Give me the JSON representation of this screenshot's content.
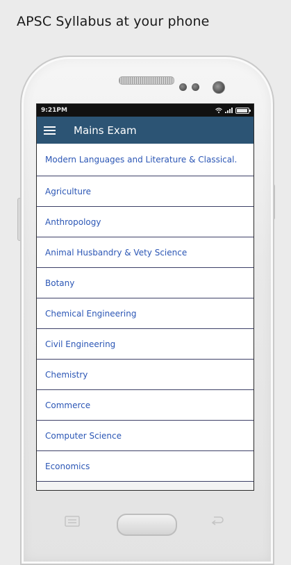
{
  "promo": {
    "title": "APSC Syllabus at your phone"
  },
  "status_bar": {
    "time": "9:21PM",
    "battery_level": 0.85
  },
  "app_bar": {
    "title": "Mains Exam"
  },
  "subjects": [
    "Modern Languages and Literature & Classical.",
    "Agriculture",
    "Anthropology",
    "Animal Husbandry & Vety Science",
    "Botany",
    "Chemical Engineering",
    "Civil Engineering",
    "Chemistry",
    "Commerce",
    "Computer Science",
    "Economics"
  ],
  "colors": {
    "app_bar": "#2c5474",
    "link_text": "#2b56b5",
    "divider": "#3c3f66"
  }
}
